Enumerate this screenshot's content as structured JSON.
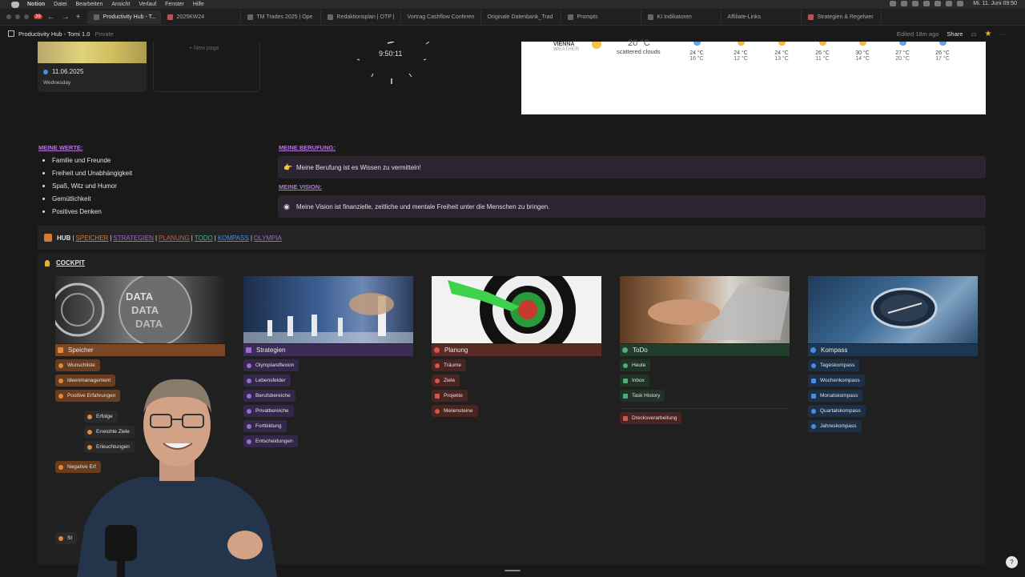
{
  "menubar": {
    "items": [
      "Notion",
      "Datei",
      "Bearbeiten",
      "Ansicht",
      "Verlauf",
      "Fenster",
      "Hilfe"
    ],
    "clock": "Mi. 11. Juni 09:50"
  },
  "tabs": {
    "badge": "39",
    "items": [
      {
        "label": "Productivity Hub - T..."
      },
      {
        "label": "2025KW24"
      },
      {
        "label": "TM Trades 2025 | Ope"
      },
      {
        "label": "Redaktionsplan | OTP |"
      },
      {
        "label": "Vortrag Cashflow Conferen"
      },
      {
        "label": "Originale Datenbank_Trad"
      },
      {
        "label": "Prompts"
      },
      {
        "label": "KI Indikatoren"
      },
      {
        "label": "Affiliate-Links"
      },
      {
        "label": "Strategien & Regelwer"
      }
    ]
  },
  "pagebar": {
    "title": "Productivity Hub - Tomi 1.0",
    "privacy": "Private",
    "edited": "Edited 18m ago",
    "share": "Share"
  },
  "date_card": {
    "date": "11.06.2025",
    "weekday": "Wednesday"
  },
  "new_page": "+ New page",
  "clock": {
    "time": "9:50:11"
  },
  "weather": {
    "city": "VIENNA",
    "label": "WEATHER",
    "temp": "20 °C",
    "condition": "scattered clouds",
    "forecast": [
      {
        "hi": "24 °C",
        "lo": "16 °C",
        "icon": "cloud-icon"
      },
      {
        "hi": "24 °C",
        "lo": "12 °C",
        "icon": "sun-icon"
      },
      {
        "hi": "24 °C",
        "lo": "13 °C",
        "icon": "sun-icon"
      },
      {
        "hi": "26 °C",
        "lo": "11 °C",
        "icon": "sun-icon"
      },
      {
        "hi": "30 °C",
        "lo": "14 °C",
        "icon": "sun-icon"
      },
      {
        "hi": "27 °C",
        "lo": "20 °C",
        "icon": "cloud-icon"
      },
      {
        "hi": "26 °C",
        "lo": "17 °C",
        "icon": "cloud-icon"
      }
    ]
  },
  "werte": {
    "title": "MEINE WERTE:",
    "items": [
      "Familie und Freunde",
      "Freiheit und Unabhängigkeit",
      "Spaß, Witz und Humor",
      "Gemütlichkeit",
      "Positives Denken"
    ]
  },
  "berufung": {
    "title": "MEINE BERUFUNG:",
    "text": "Meine Berufung ist es Wissen zu vermitteln!"
  },
  "vision": {
    "title": "MEINE VISION:",
    "text": "Meine Vision ist finanzielle, zeitliche und mentale Freiheit unter die Menschen zu bringen."
  },
  "hub": {
    "label": "HUB",
    "links": [
      {
        "label": "SPEICHER",
        "color": "#d8793a"
      },
      {
        "label": "STRATEGIEN",
        "color": "#9b6bd1"
      },
      {
        "label": "PLANUNG",
        "color": "#d0574c"
      },
      {
        "label": "TODO",
        "color": "#4caf7a"
      },
      {
        "label": "KOMPASS",
        "color": "#4a8de0"
      },
      {
        "label": "OLYMPIA",
        "color": "#9b6bd1"
      }
    ]
  },
  "cockpit": {
    "title": "COCKPIT",
    "speicher": {
      "label": "Speicher",
      "items": [
        "Wunschliste",
        "Ideenmanagement",
        "Positive Erfahrungen"
      ],
      "sub_items": [
        "Erfolge",
        "Erreichte Ziele",
        "Erleuchtungen"
      ],
      "negative": "Negative Erf",
      "bottom": "St"
    },
    "strategien": {
      "label": "Strategien",
      "items": [
        "Olympiareflexion",
        "Lebensfelder",
        "Berufsbereiche",
        "Privatbereiche",
        "Fortbildung",
        "Entscheidungen"
      ]
    },
    "planung": {
      "label": "Planung",
      "items": [
        "Träume",
        "Ziele",
        "Projekte",
        "Meilensteine"
      ]
    },
    "todo": {
      "label": "ToDo",
      "items": [
        "Heute",
        "Inbox",
        "Task History"
      ],
      "extra": "Drecksverarbeitung"
    },
    "kompass": {
      "label": "Kompass",
      "items": [
        "Tageskompass",
        "Wochenkompass",
        "Monatskompass",
        "Quartalskompass",
        "Jahreskompass"
      ]
    },
    "data_image_text": "DATA"
  },
  "help": "?",
  "colors": {
    "speicher": "#7a4623",
    "strategien": "#3d2d55",
    "planung": "#5a2a25",
    "todo": "#233d2c",
    "kompass": "#1f3650"
  }
}
